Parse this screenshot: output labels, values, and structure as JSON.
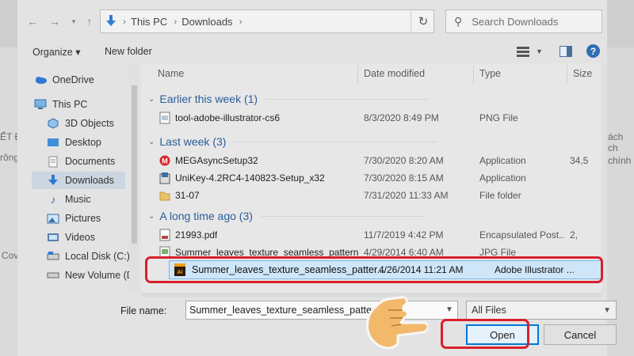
{
  "address": {
    "crumbs": [
      "This PC",
      "Downloads"
    ]
  },
  "search": {
    "placeholder": "Search Downloads"
  },
  "toolbar": {
    "organize": "Organize ▾",
    "new_folder": "New folder"
  },
  "nav": {
    "items": [
      {
        "label": "OneDrive",
        "icon": "onedrive-cloud-icon"
      },
      {
        "label": "This PC",
        "icon": "computer-icon"
      },
      {
        "label": "3D Objects",
        "icon": "3d-objects-icon"
      },
      {
        "label": "Desktop",
        "icon": "desktop-icon"
      },
      {
        "label": "Documents",
        "icon": "documents-icon"
      },
      {
        "label": "Downloads",
        "icon": "download-arrow-icon",
        "selected": true
      },
      {
        "label": "Music",
        "icon": "music-icon"
      },
      {
        "label": "Pictures",
        "icon": "pictures-icon"
      },
      {
        "label": "Videos",
        "icon": "videos-icon"
      },
      {
        "label": "Local Disk (C:)",
        "icon": "local-disk-icon"
      },
      {
        "label": "New Volume (D:",
        "icon": "volume-drive-icon"
      }
    ]
  },
  "columns": {
    "name": "Name",
    "date": "Date modified",
    "type": "Type",
    "size": "Size"
  },
  "groups": [
    {
      "label": "Earlier this week (1)",
      "files": [
        {
          "name": "tool-adobe-illustrator-cs6",
          "date": "8/3/2020 8:49 PM",
          "type": "PNG File",
          "size": "",
          "icon": "png-file-icon"
        }
      ]
    },
    {
      "label": "Last week (3)",
      "files": [
        {
          "name": "MEGAsyncSetup32",
          "date": "7/30/2020 8:20 AM",
          "type": "Application",
          "size": "34,5",
          "icon": "mega-app-icon"
        },
        {
          "name": "UniKey-4.2RC4-140823-Setup_x32",
          "date": "7/30/2020 8:15 AM",
          "type": "Application",
          "size": "",
          "icon": "installer-icon"
        },
        {
          "name": "31-07",
          "date": "7/31/2020 11:33 AM",
          "type": "File folder",
          "size": "",
          "icon": "folder-icon"
        }
      ]
    },
    {
      "label": "A long time ago (3)",
      "files": [
        {
          "name": "21993.pdf",
          "date": "11/7/2019 4:42 PM",
          "type": "Encapsulated Post...",
          "size": "2,",
          "icon": "pdf-file-icon"
        },
        {
          "name": "Summer_leaves_texture_seamless_pattern",
          "date": "4/29/2014 6:40 AM",
          "type": "JPG File",
          "size": "",
          "icon": "jpg-file-icon"
        },
        {
          "name": "Summer_leaves_texture_seamless_patter...",
          "date": "4/26/2014 11:21 AM",
          "type": "Adobe Illustrator ...",
          "size": "",
          "icon": "illustrator-file-icon",
          "selected": true
        }
      ]
    }
  ],
  "footer": {
    "file_name_label": "File name:",
    "file_name_value": "Summer_leaves_texture_seamless_pattern.pd",
    "filter": "All Files",
    "open": "Open",
    "cancel": "Cancel"
  },
  "background_doc": {
    "left_a": "ẾT Đ",
    "left_b": "rông",
    "left_c": "Cov",
    "right_a": "ách ch",
    "right_b": "chính"
  },
  "colors": {
    "highlight": "#d9202c",
    "selection": "#cfe6f8",
    "accent": "#0078d7",
    "group_header": "#2b5d99"
  }
}
